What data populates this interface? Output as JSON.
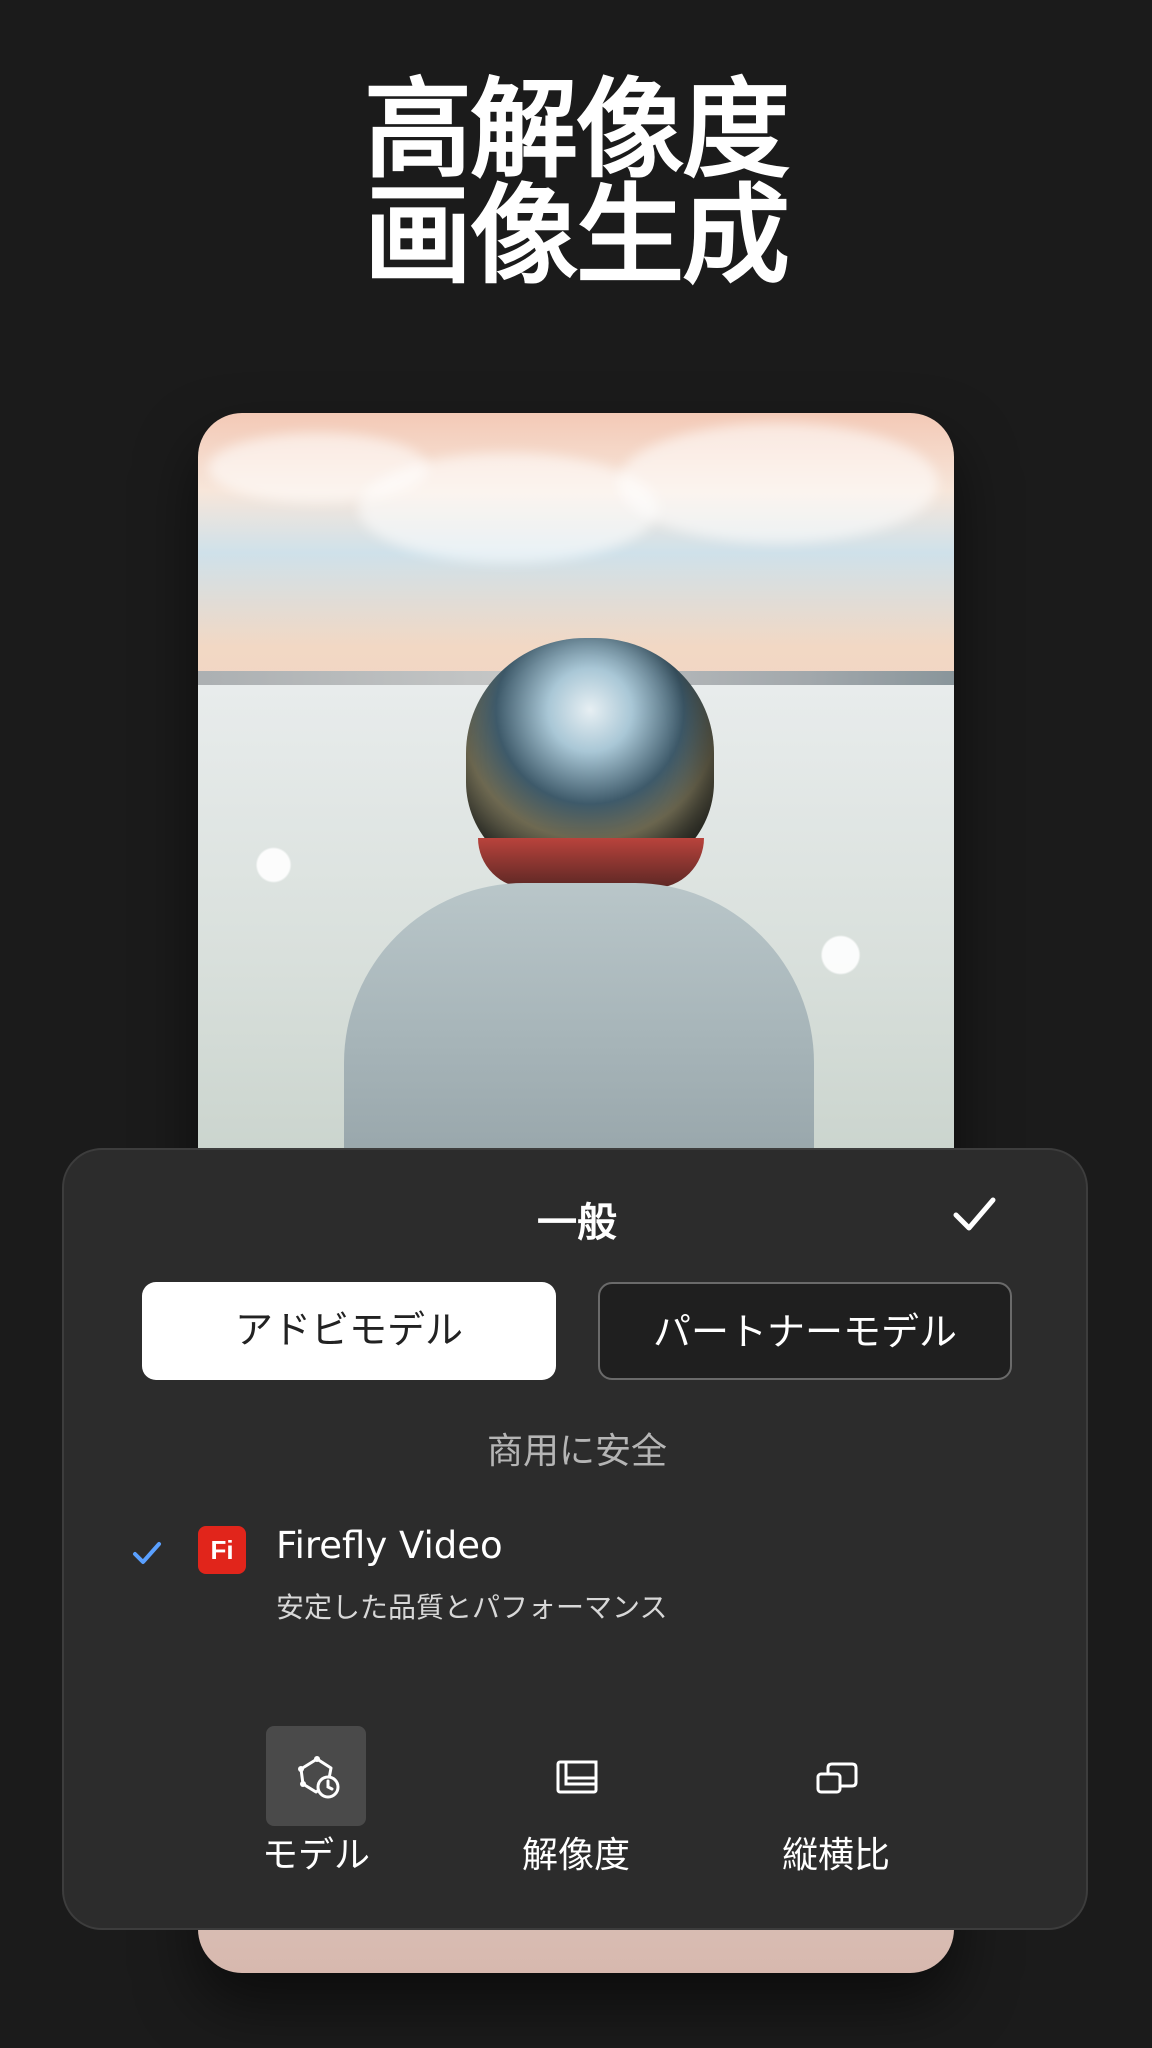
{
  "headline": {
    "line1": "高解像度",
    "line2": "画像生成"
  },
  "preview": {
    "image": "astronaut-helmet-hoodie-flower-field"
  },
  "panel": {
    "title": "一般",
    "confirm_icon": "checkmark-icon",
    "segments": {
      "active_label": "アドビモデル",
      "inactive_label": "パートナーモデル"
    },
    "section_label": "商用に安全",
    "model": {
      "name": "Firefly Video",
      "description": "安定した品質とパフォーマンス",
      "logo_text": "Fi",
      "logo_color": "#e1251b",
      "check_color": "#5aa0ff",
      "selected": true
    },
    "tools": [
      {
        "label": "モデル",
        "icon": "model-icon",
        "active": true
      },
      {
        "label": "解像度",
        "icon": "resolution-icon",
        "active": false
      },
      {
        "label": "縦横比",
        "icon": "aspect-ratio-icon",
        "active": false
      }
    ]
  }
}
